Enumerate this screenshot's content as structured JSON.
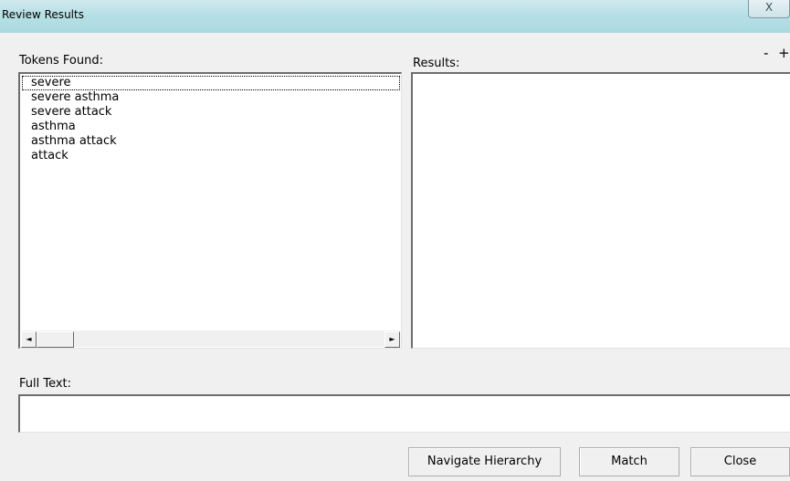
{
  "window": {
    "title": "Review Results",
    "close_glyph": "x̣"
  },
  "tokens": {
    "label": "Tokens Found:",
    "items": [
      "severe",
      "severe asthma",
      "severe attack",
      "asthma",
      "asthma attack",
      "attack"
    ],
    "selected_index": 0,
    "scroll_left_glyph": "◄",
    "scroll_right_glyph": "►"
  },
  "results": {
    "label": "Results:",
    "zoom_out": "-",
    "zoom_in": "+"
  },
  "full_text": {
    "label": "Full Text:",
    "value": ""
  },
  "buttons": {
    "navigate": "Navigate Hierarchy",
    "match": "Match",
    "close": "Close"
  }
}
